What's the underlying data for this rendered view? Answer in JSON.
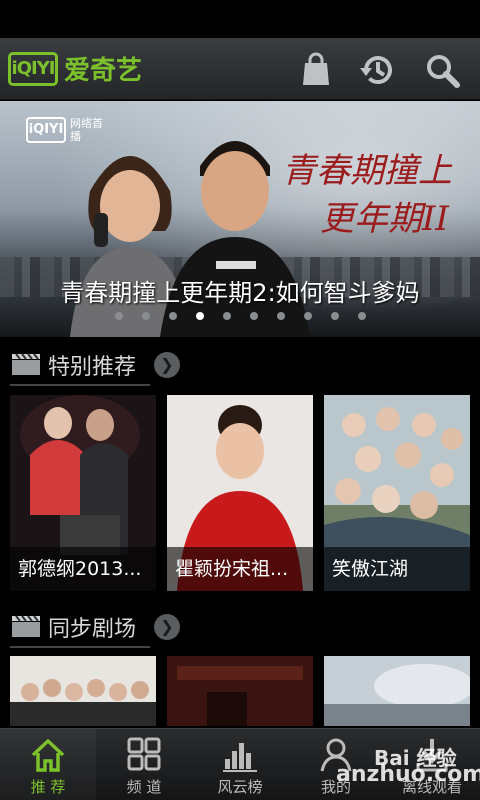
{
  "app": {
    "logo_badge": "iQIYI",
    "logo_name": "爱奇艺",
    "accent": "#7cc12c"
  },
  "header": {
    "icons": [
      "shopping-bag-icon",
      "history-icon",
      "search-icon"
    ]
  },
  "banner": {
    "badge": "iQIYI",
    "badge_sub": "网络首播",
    "calligraphy_line1": "青春期撞上",
    "calligraphy_line2": "更年期II",
    "title": "青春期撞上更年期2:如何智斗爹妈",
    "slide_count": 10,
    "active_index": 3
  },
  "sections": [
    {
      "title": "特别推荐",
      "items": [
        {
          "caption": "郭德纲2013..."
        },
        {
          "caption": "瞿颖扮宋祖..."
        },
        {
          "caption": "笑傲江湖"
        }
      ]
    },
    {
      "title": "同步剧场",
      "items": [
        {
          "caption": ""
        },
        {
          "caption": ""
        },
        {
          "caption": ""
        }
      ]
    }
  ],
  "tabs": [
    {
      "label": "推 荐",
      "icon": "home-icon",
      "active": true
    },
    {
      "label": "频 道",
      "icon": "grid-icon",
      "active": false
    },
    {
      "label": "风云榜",
      "icon": "bar-chart-icon",
      "active": false
    },
    {
      "label": "我的",
      "icon": "user-icon",
      "active": false
    },
    {
      "label": "离线观看",
      "icon": "download-icon",
      "active": false
    }
  ],
  "watermark": {
    "line1": "Bai 经验",
    "line2": "anzhuo.com"
  }
}
